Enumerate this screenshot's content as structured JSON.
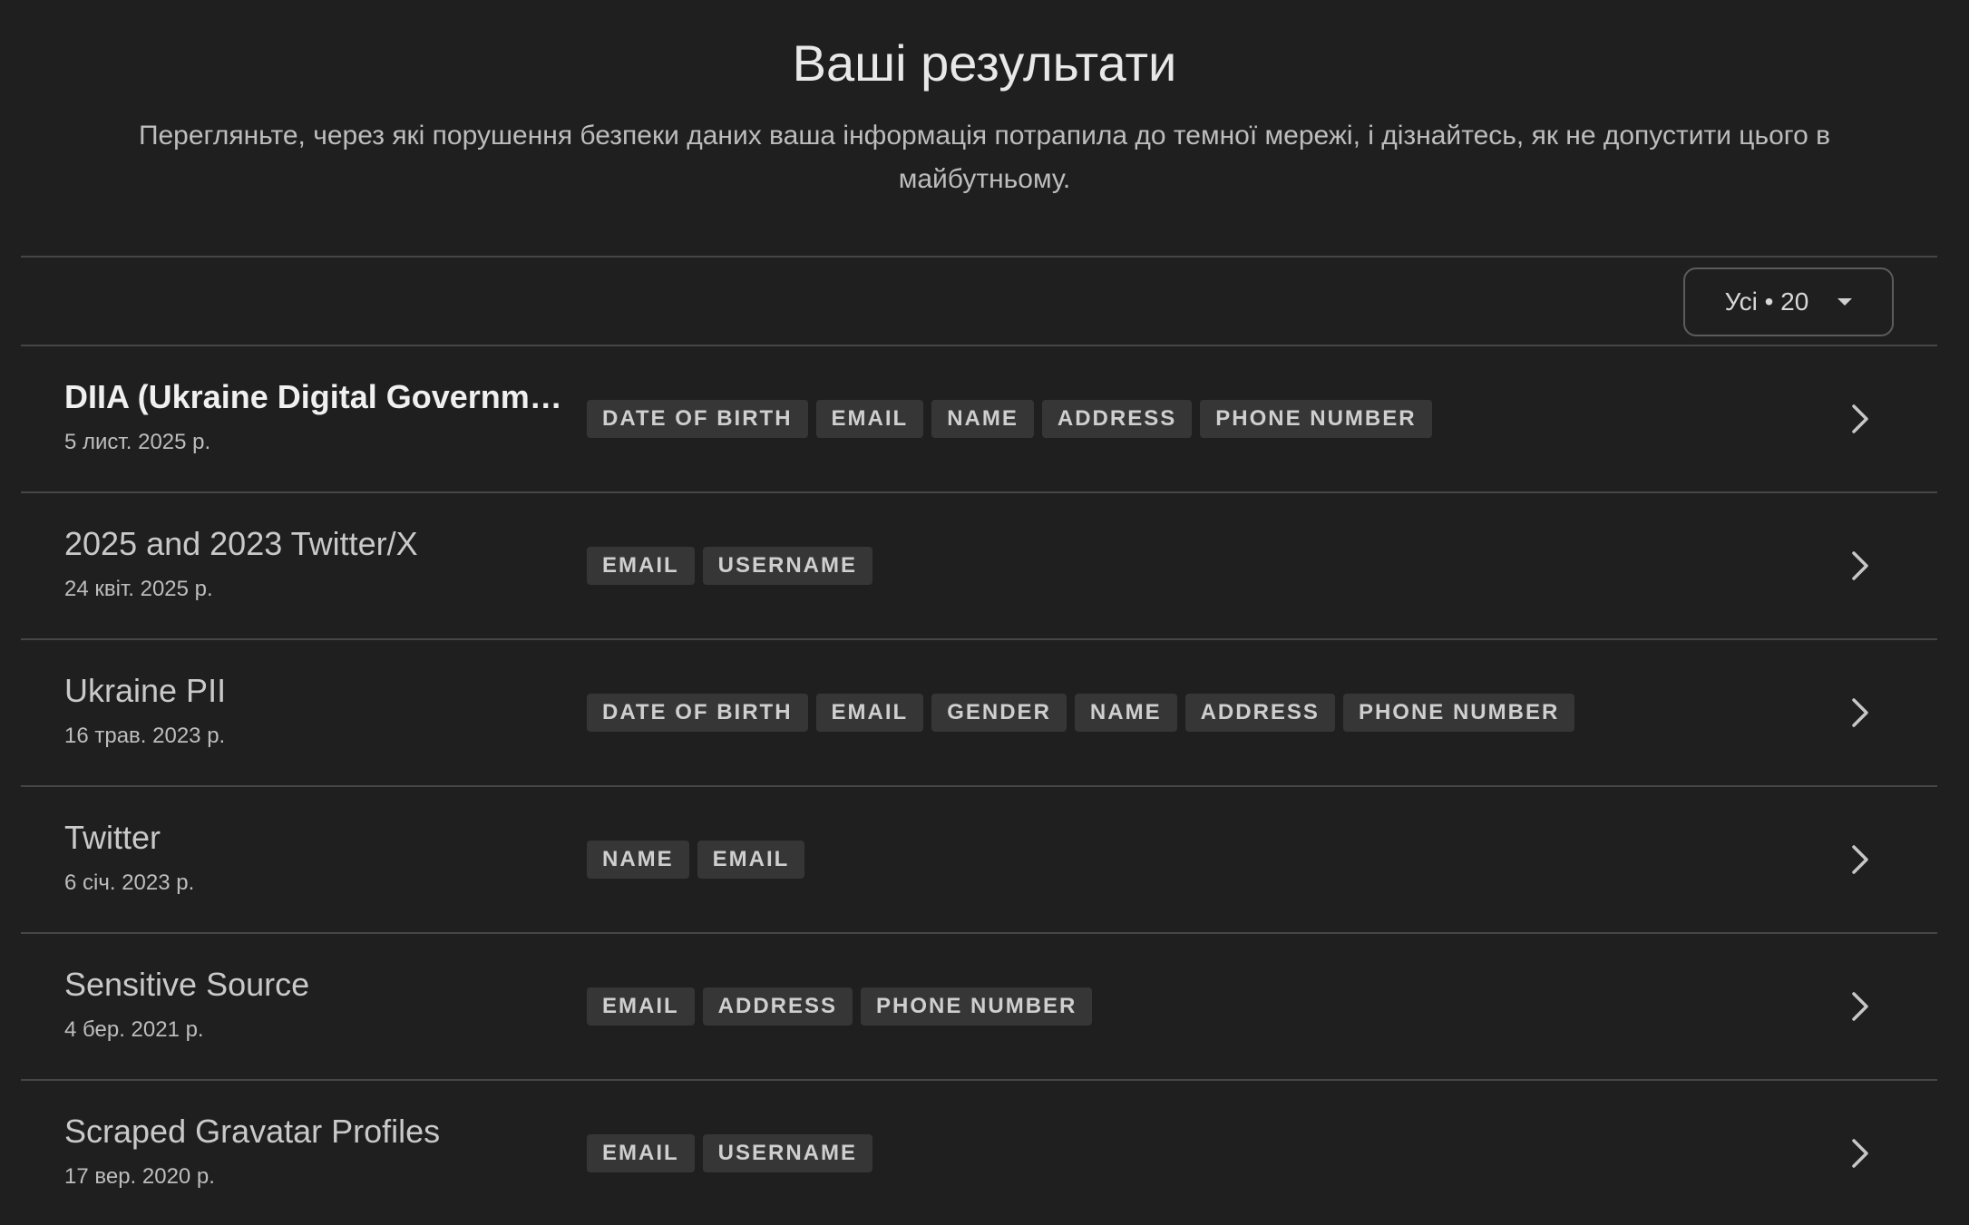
{
  "header": {
    "title": "Ваші результати",
    "subtitle": "Перегляньте, через які порушення безпеки даних ваша інформація потрапила до темної мережі, і дізнайтесь, як не допустити цього в майбутньому."
  },
  "filter": {
    "label": "Усі • 20"
  },
  "breaches": [
    {
      "title": "DIIA (Ukraine Digital Governm…",
      "date": "5 лист. 2025 р.",
      "bold": true,
      "tags": [
        "DATE OF BIRTH",
        "EMAIL",
        "NAME",
        "ADDRESS",
        "PHONE NUMBER"
      ]
    },
    {
      "title": "2025 and 2023 Twitter/X",
      "date": "24 квіт. 2025 р.",
      "bold": false,
      "tags": [
        "EMAIL",
        "USERNAME"
      ]
    },
    {
      "title": "Ukraine PII",
      "date": "16 трав. 2023 р.",
      "bold": false,
      "tags": [
        "DATE OF BIRTH",
        "EMAIL",
        "GENDER",
        "NAME",
        "ADDRESS",
        "PHONE NUMBER"
      ]
    },
    {
      "title": "Twitter",
      "date": "6 січ. 2023 р.",
      "bold": false,
      "tags": [
        "NAME",
        "EMAIL"
      ]
    },
    {
      "title": "Sensitive Source",
      "date": "4 бер. 2021 р.",
      "bold": false,
      "tags": [
        "EMAIL",
        "ADDRESS",
        "PHONE NUMBER"
      ]
    },
    {
      "title": "Scraped Gravatar Profiles",
      "date": "17 вер. 2020 р.",
      "bold": false,
      "tags": [
        "EMAIL",
        "USERNAME"
      ]
    }
  ],
  "icons": {
    "row_arrow": "chevron-right-icon",
    "filter_arrow": "caret-down-icon"
  },
  "colors": {
    "background": "#1f1f1f",
    "tag_background": "#363636",
    "divider": "#444746"
  }
}
